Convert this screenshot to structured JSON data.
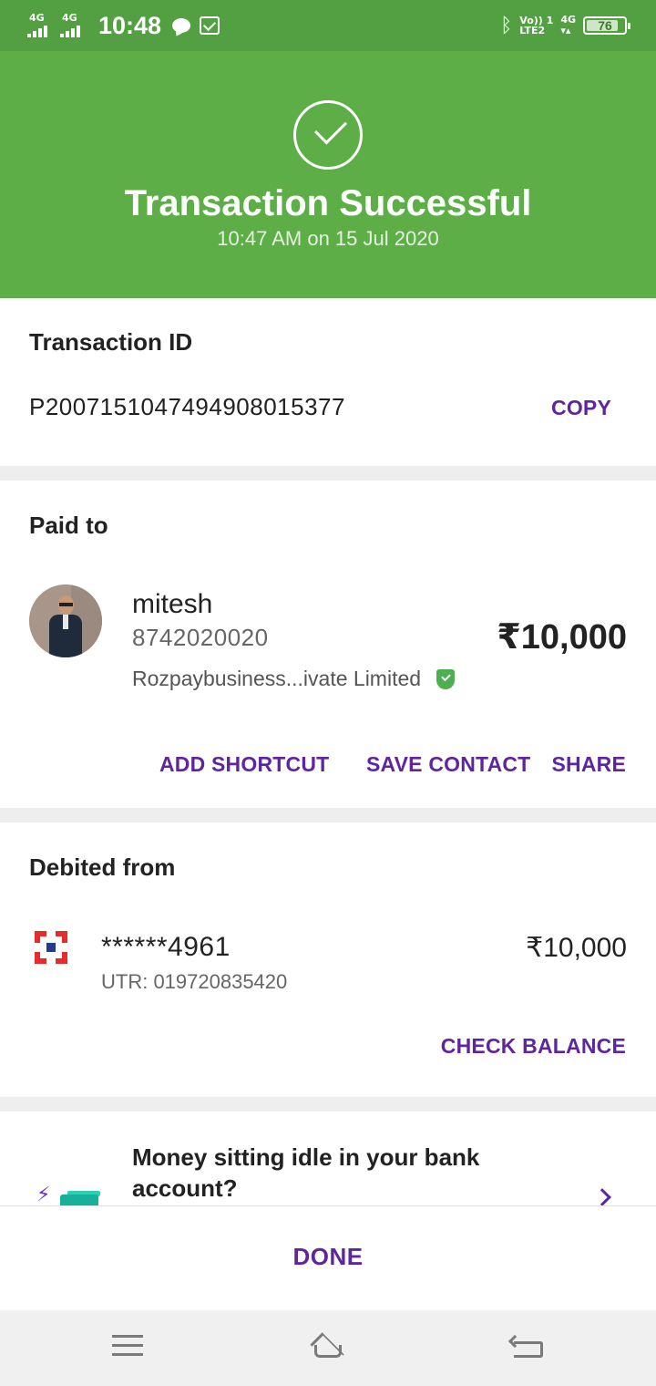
{
  "status_bar": {
    "sim1_network": "4G",
    "sim2_network": "4G",
    "time": "10:48",
    "volte_label": "Vo)) 1",
    "lte_label": "LTE2",
    "net2_label": "4G",
    "battery": "76",
    "icons": [
      "chat-icon",
      "mail-icon",
      "bluetooth-icon"
    ]
  },
  "header": {
    "title": "Transaction Successful",
    "time": "10:47 AM on 15 Jul 2020",
    "bg_color": "#5eae48"
  },
  "transaction": {
    "label": "Transaction ID",
    "id": "P2007151047494908015377",
    "copy_label": "COPY"
  },
  "paid_to": {
    "label": "Paid to",
    "name": "mitesh",
    "phone": "8742020020",
    "org": "Rozpaybusiness...ivate Limited",
    "amount": "₹10,000",
    "actions": {
      "add_shortcut": "ADD SHORTCUT",
      "save_contact": "SAVE CONTACT",
      "share": "SHARE"
    }
  },
  "debited_from": {
    "label": "Debited from",
    "account": "******4961",
    "utr": "UTR: 019720835420",
    "amount": "₹10,000",
    "check_balance": "CHECK BALANCE"
  },
  "promo": {
    "text": "Money sitting idle in your bank account?"
  },
  "done_label": "DONE",
  "accent_color": "#5f259f"
}
